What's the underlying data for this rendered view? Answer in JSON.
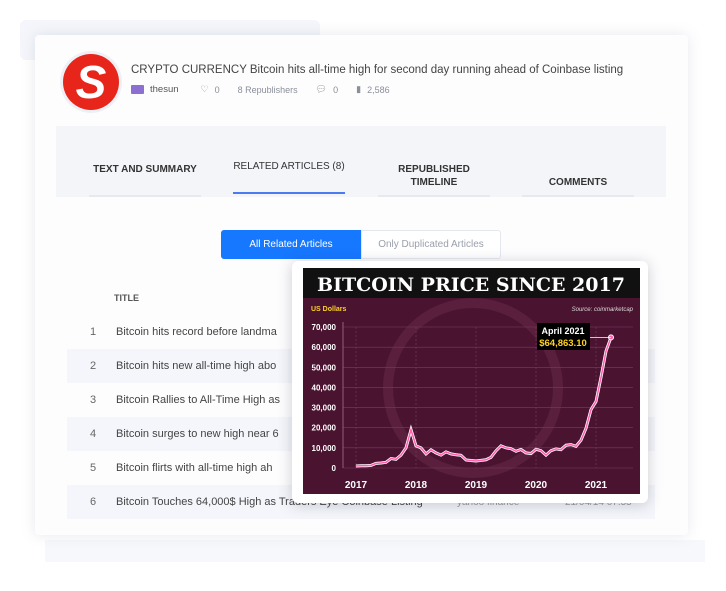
{
  "article": {
    "logo_letter": "S",
    "title": "CRYPTO CURRENCY Bitcoin hits all-time high for second day running ahead of Coinbase listing",
    "source": "thesun",
    "likes": "0",
    "republishers": "8 Republishers",
    "comments": "0",
    "views": "2,586"
  },
  "tabs": [
    {
      "label": "TEXT AND SUMMARY",
      "active": false
    },
    {
      "label": "RELATED ARTICLES (8)",
      "active": true
    },
    {
      "label": "REPUBLISHED TIMELINE",
      "active": false
    },
    {
      "label": "COMMENTS",
      "active": false
    }
  ],
  "filters": {
    "all": "All Related Articles",
    "duplicated": "Only Duplicated Articles",
    "active": "all"
  },
  "table": {
    "header_title": "TITLE",
    "rows": [
      {
        "n": "1",
        "title": "Bitcoin hits record before landma",
        "source": "",
        "date": ""
      },
      {
        "n": "2",
        "title": "Bitcoin hits new all-time high abo",
        "source": "",
        "date": ""
      },
      {
        "n": "3",
        "title": "Bitcoin Rallies to All-Time High as",
        "source": "",
        "date": ""
      },
      {
        "n": "4",
        "title": "Bitcoin surges to new high near 6",
        "source": "",
        "date": ""
      },
      {
        "n": "5",
        "title": "Bitcoin flirts with all-time high ah",
        "source": "",
        "date": ""
      },
      {
        "n": "6",
        "title": "Bitcoin Touches 64,000$ High as Traders Eye Coinbase Listing",
        "source": "yahoo finance",
        "date": "21/04/14 07:55"
      }
    ]
  },
  "colors": {
    "accent": "#1677ff",
    "logo": "#e8251b",
    "chart_bg": "#4a1430",
    "chart_line": "#ff5fb0",
    "highlight": "#ffd21f"
  },
  "chart_data": {
    "type": "line",
    "title": "BITCOIN PRICE SINCE 2017",
    "ylabel": "US Dollars",
    "source": "Source: coinmarketcap",
    "ylim": [
      0,
      70000
    ],
    "yticks": [
      "70,000",
      "60,000",
      "50,000",
      "40,000",
      "30,000",
      "20,000",
      "10,000",
      "0"
    ],
    "xticks": [
      "2017",
      "2018",
      "2019",
      "2020",
      "2021"
    ],
    "annotation": {
      "label": "April 2021",
      "value": "$64,863.10"
    },
    "x": [
      "2017-01",
      "2017-02",
      "2017-03",
      "2017-04",
      "2017-05",
      "2017-06",
      "2017-07",
      "2017-08",
      "2017-09",
      "2017-10",
      "2017-11",
      "2017-12",
      "2018-01",
      "2018-02",
      "2018-03",
      "2018-04",
      "2018-05",
      "2018-06",
      "2018-07",
      "2018-08",
      "2018-09",
      "2018-10",
      "2018-11",
      "2018-12",
      "2019-01",
      "2019-02",
      "2019-03",
      "2019-04",
      "2019-05",
      "2019-06",
      "2019-07",
      "2019-08",
      "2019-09",
      "2019-10",
      "2019-11",
      "2019-12",
      "2020-01",
      "2020-02",
      "2020-03",
      "2020-04",
      "2020-05",
      "2020-06",
      "2020-07",
      "2020-08",
      "2020-09",
      "2020-10",
      "2020-11",
      "2020-12",
      "2021-01",
      "2021-02",
      "2021-03",
      "2021-04"
    ],
    "values": [
      1000,
      1100,
      1100,
      1300,
      2300,
      2500,
      2800,
      4700,
      4300,
      6400,
      10000,
      19000,
      11000,
      10000,
      7000,
      9000,
      7500,
      6400,
      8000,
      7000,
      6600,
      6300,
      4000,
      3700,
      3500,
      3800,
      4100,
      5300,
      8500,
      11000,
      10000,
      9600,
      8300,
      9200,
      7500,
      7200,
      9300,
      8600,
      6400,
      8600,
      9500,
      9100,
      11300,
      11600,
      10800,
      13800,
      19700,
      29000,
      33000,
      45000,
      58000,
      64863
    ]
  }
}
